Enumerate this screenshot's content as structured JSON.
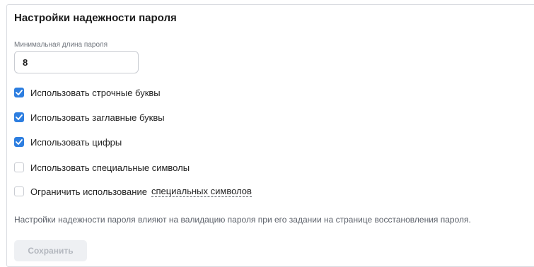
{
  "section": {
    "title": "Настройки надежности пароля"
  },
  "min_length": {
    "label": "Минимальная длина пароля",
    "value": "8"
  },
  "options": [
    {
      "label": "Использовать строчные буквы",
      "checked": true
    },
    {
      "label": "Использовать заглавные буквы",
      "checked": true
    },
    {
      "label": "Использовать цифры",
      "checked": true
    },
    {
      "label": "Использовать специальные символы",
      "checked": false
    },
    {
      "label": "Ограничить использование",
      "link": "специальных символов",
      "checked": false
    }
  ],
  "hint": "Настройки надежности пароля влияют на валидацию пароля при его задании на странице восстановления пароля.",
  "buttons": {
    "save": "Сохранить"
  },
  "colors": {
    "accent": "#2d7ee0",
    "disabled_button_bg": "#eef0f3",
    "disabled_button_text": "#b3b7be"
  }
}
